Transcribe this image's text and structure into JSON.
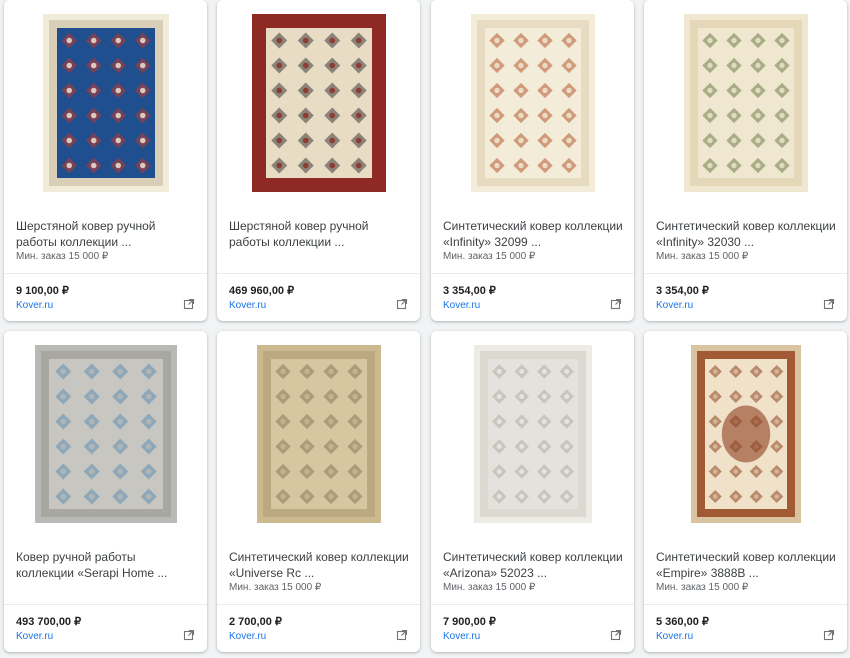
{
  "products": [
    {
      "title": "Шерстяной ковер ручной работы коллекции ...",
      "min_order": "Мин. заказ 15 000 ₽",
      "price": "9 100,00 ₽",
      "store": "Kover.ru",
      "colors": {
        "bg": "#f1ebd9",
        "field": "#1f4f8e",
        "border": "#d9cfb6",
        "accent": "#c0392b"
      }
    },
    {
      "title": "Шерстяной ковер ручной работы коллекции ...",
      "min_order": "",
      "price": "469 960,00 ₽",
      "store": "Kover.ru",
      "colors": {
        "bg": "#8e2a23",
        "field": "#e8dcc4",
        "border": "#8e2a23",
        "accent": "#3b3b3b"
      }
    },
    {
      "title": "Синтетический ковер коллекции «Infinity» 32099 ...",
      "min_order": "Мин. заказ 15 000 ₽",
      "price": "3 354,00 ₽",
      "store": "Kover.ru",
      "colors": {
        "bg": "#f3ecd9",
        "field": "#f3ecd9",
        "border": "#e7dcc1",
        "accent": "#b35a2e"
      }
    },
    {
      "title": "Синтетический ковер коллекции «Infinity» 32030 ...",
      "min_order": "Мин. заказ 15 000 ₽",
      "price": "3 354,00 ₽",
      "store": "Kover.ru",
      "colors": {
        "bg": "#efe7d0",
        "field": "#efe7d0",
        "border": "#e4d8b8",
        "accent": "#6f7d48"
      }
    },
    {
      "title": "Ковер ручной работы коллекции «Serapi Home ...",
      "min_order": "",
      "price": "493 700,00 ₽",
      "store": "Kover.ru",
      "colors": {
        "bg": "#b9b9b5",
        "field": "#c7c6c1",
        "border": "#a8a7a2",
        "accent": "#5f8fb5"
      }
    },
    {
      "title": "Синтетический ковер коллекции «Universe Rc ...",
      "min_order": "Мин. заказ 15 000 ₽",
      "price": "2 700,00 ₽",
      "store": "Kover.ru",
      "colors": {
        "bg": "#cbb98f",
        "field": "#d6c7a1",
        "border": "#bca981",
        "accent": "#8a7a57"
      }
    },
    {
      "title": "Синтетический ковер коллекции «Arizona» 52023 ...",
      "min_order": "Мин. заказ 15 000 ₽",
      "price": "7 900,00 ₽",
      "store": "Kover.ru",
      "colors": {
        "bg": "#ecebe6",
        "field": "#e4e2dc",
        "border": "#dcd9d1",
        "accent": "#b0ada5"
      }
    },
    {
      "title": "Синтетический ковер коллекции «Empire» 3888B ...",
      "min_order": "Мин. заказ 15 000 ₽",
      "price": "5 360,00 ₽",
      "store": "Kover.ru",
      "colors": {
        "bg": "#d9c3a0",
        "field": "#efe2c9",
        "border": "#a25a34",
        "accent": "#8e3f22"
      }
    }
  ],
  "icons": {
    "external_link": "open-in-new-icon"
  }
}
